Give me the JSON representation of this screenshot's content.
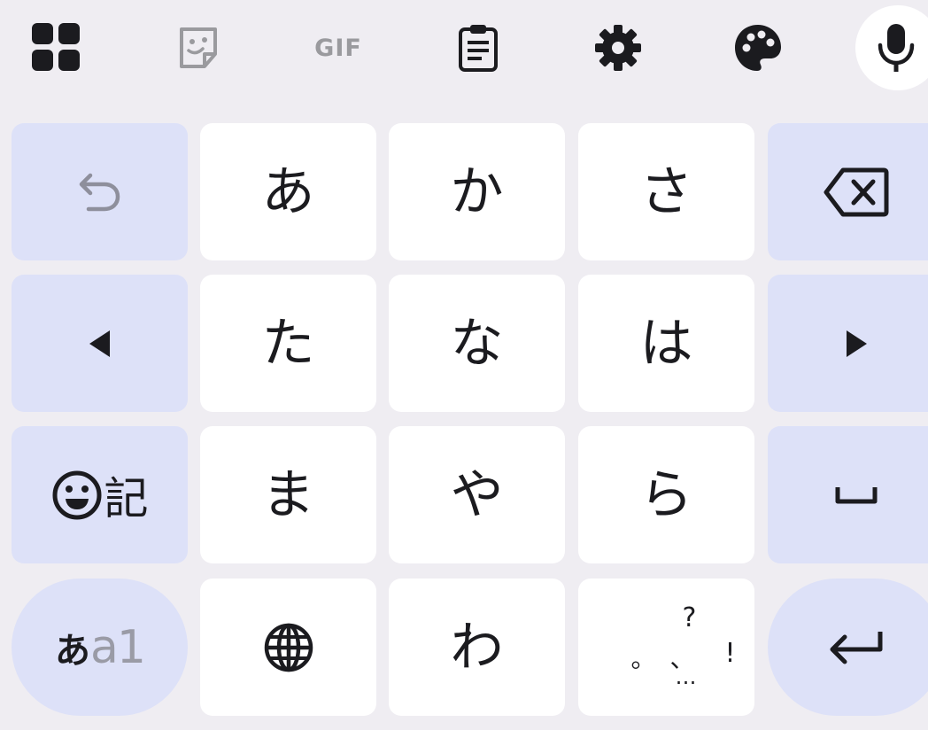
{
  "toolbar": {
    "gif_label": "GIF",
    "items": [
      "apps-grid-icon",
      "sticker-icon",
      "gif",
      "clipboard-icon",
      "gear-icon",
      "palette-icon",
      "microphone-icon"
    ]
  },
  "keys": {
    "undo_icon": "undo-icon",
    "a": "あ",
    "ka": "か",
    "sa": "さ",
    "backspace_icon": "backspace-icon",
    "left_icon": "cursor-left-icon",
    "ta": "た",
    "na": "な",
    "ha": "は",
    "right_icon": "cursor-right-icon",
    "emoji_symbol_label": "記",
    "ma": "ま",
    "ya": "や",
    "ra": "ら",
    "space_icon": "space-icon",
    "mode_kana": "あ",
    "mode_alpha": "a1",
    "globe_icon": "globe-icon",
    "wa": "わ",
    "punct_question": "?",
    "punct_maru": "。",
    "punct_ten": "、",
    "punct_exclaim": "!",
    "punct_ellipsis": "…",
    "enter_icon": "enter-icon"
  },
  "colors": {
    "background": "#efedf2",
    "key": "#ffffff",
    "function_key": "#dde1f8",
    "text": "#1b1b1f",
    "muted": "#9a9a9e"
  }
}
